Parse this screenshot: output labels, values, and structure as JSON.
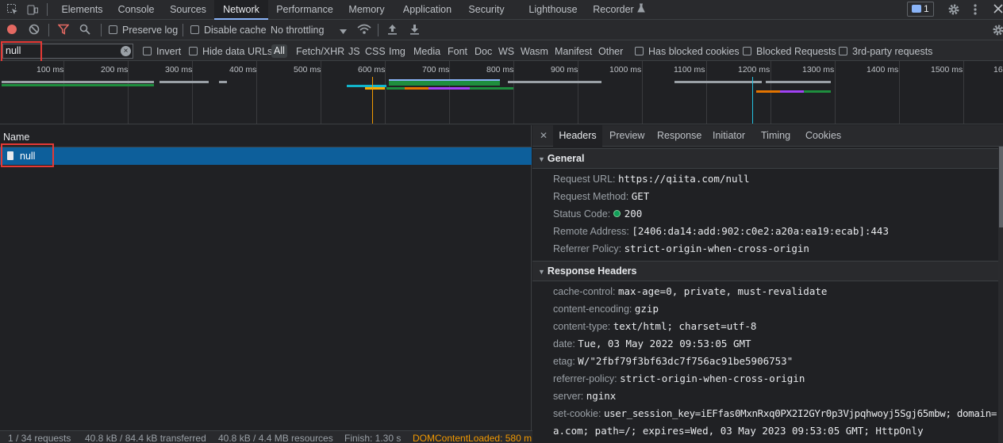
{
  "devtools_tabs": [
    {
      "label": "Elements"
    },
    {
      "label": "Console"
    },
    {
      "label": "Sources"
    },
    {
      "label": "Network",
      "active": true
    },
    {
      "label": "Performance"
    },
    {
      "label": "Memory"
    },
    {
      "label": "Application"
    },
    {
      "label": "Security"
    },
    {
      "label": "Lighthouse"
    },
    {
      "label": "Recorder"
    }
  ],
  "message_count": "1",
  "toolbar": {
    "preserve_log": "Preserve log",
    "disable_cache": "Disable cache",
    "throttling": "No throttling"
  },
  "filter": {
    "value": "null",
    "invert": "Invert",
    "hide_data_urls": "Hide data URLs",
    "types": [
      "All",
      "Fetch/XHR",
      "JS",
      "CSS",
      "Img",
      "Media",
      "Font",
      "Doc",
      "WS",
      "Wasm",
      "Manifest",
      "Other"
    ],
    "has_blocked_cookies": "Has blocked cookies",
    "blocked_requests": "Blocked Requests",
    "third_party": "3rd-party requests"
  },
  "overview": {
    "ticks": [
      "100 ms",
      "200 ms",
      "300 ms",
      "400 ms",
      "500 ms",
      "600 ms",
      "700 ms",
      "800 ms",
      "900 ms",
      "1000 ms",
      "1100 ms",
      "1200 ms",
      "1300 ms",
      "1400 ms",
      "1500 ms",
      "16"
    ]
  },
  "request_list": {
    "column": "Name",
    "rows": [
      {
        "name": "null"
      }
    ]
  },
  "detail": {
    "tabs": [
      "Headers",
      "Preview",
      "Response",
      "Initiator",
      "Timing",
      "Cookies"
    ],
    "general": {
      "title": "General",
      "rows": [
        {
          "key": "Request URL:",
          "value": "https://qiita.com/null"
        },
        {
          "key": "Request Method:",
          "value": "GET"
        },
        {
          "key": "Status Code:",
          "value": "200"
        },
        {
          "key": "Remote Address:",
          "value": "[2406:da14:add:902:c0e2:a20a:ea19:ecab]:443"
        },
        {
          "key": "Referrer Policy:",
          "value": "strict-origin-when-cross-origin"
        }
      ]
    },
    "response_headers": {
      "title": "Response Headers",
      "rows": [
        {
          "key": "cache-control:",
          "value": "max-age=0, private, must-revalidate"
        },
        {
          "key": "content-encoding:",
          "value": "gzip"
        },
        {
          "key": "content-type:",
          "value": "text/html; charset=utf-8"
        },
        {
          "key": "date:",
          "value": "Tue, 03 May 2022 09:53:05 GMT"
        },
        {
          "key": "etag:",
          "value": "W/\"2fbf79f3bf63dc7f756ac91be5906753\""
        },
        {
          "key": "referrer-policy:",
          "value": "strict-origin-when-cross-origin"
        },
        {
          "key": "server:",
          "value": "nginx"
        },
        {
          "key": "set-cookie:",
          "value": "user_session_key=iEFfas0MxnRxq0PX2I2GYr0p3Vjpqhwoyj5Sgj65mbw; domain=.qiit"
        },
        {
          "key": "",
          "value": "a.com; path=/; expires=Wed, 03 May 2023 09:53:05 GMT; HttpOnly"
        }
      ]
    }
  },
  "status": {
    "requests": "1 / 34 requests",
    "transferred": "40.8 kB / 84.4 kB transferred",
    "resources": "40.8 kB / 4.4 MB resources",
    "finish": "Finish: 1.30 s",
    "dcl": "DOMContentLoaded: 580 m"
  }
}
